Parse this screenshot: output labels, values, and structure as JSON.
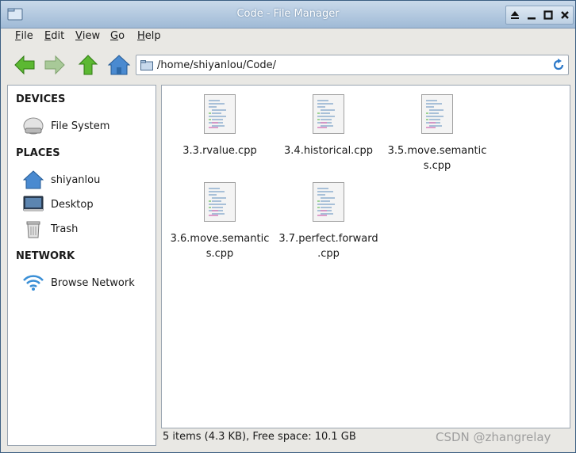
{
  "window": {
    "title": "Code - File Manager"
  },
  "menu": [
    {
      "mnemonic": "F",
      "rest": "ile"
    },
    {
      "mnemonic": "E",
      "rest": "dit"
    },
    {
      "mnemonic": "V",
      "rest": "iew"
    },
    {
      "mnemonic": "G",
      "rest": "o"
    },
    {
      "mnemonic": "H",
      "rest": "elp"
    }
  ],
  "toolbar": {
    "path": "/home/shiyanlou/Code/"
  },
  "sidebar": {
    "devices_header": "DEVICES",
    "places_header": "PLACES",
    "network_header": "NETWORK",
    "items": [
      {
        "label": "File System",
        "icon": "drive-icon"
      },
      {
        "label": "shiyanlou",
        "icon": "home-icon"
      },
      {
        "label": "Desktop",
        "icon": "desktop-icon"
      },
      {
        "label": "Trash",
        "icon": "trash-icon"
      },
      {
        "label": "Browse Network",
        "icon": "wifi-icon"
      }
    ]
  },
  "files": [
    {
      "line1": "3.3.rvalue.cpp",
      "line2": ""
    },
    {
      "line1": "3.4.historical.cpp",
      "line2": ""
    },
    {
      "line1": "3.5.move.semantic",
      "line2": "s.cpp"
    },
    {
      "line1": "3.6.move.semantic",
      "line2": "s.cpp"
    },
    {
      "line1": "3.7.perfect.forward",
      "line2": ".cpp"
    }
  ],
  "status": "5 items (4.3 KB), Free space: 10.1 GB",
  "watermark": "CSDN @zhangrelay",
  "colors": {
    "titlebar": "#9fbad6",
    "accent_green": "#4caf2a",
    "home_blue": "#3d7cc4"
  }
}
